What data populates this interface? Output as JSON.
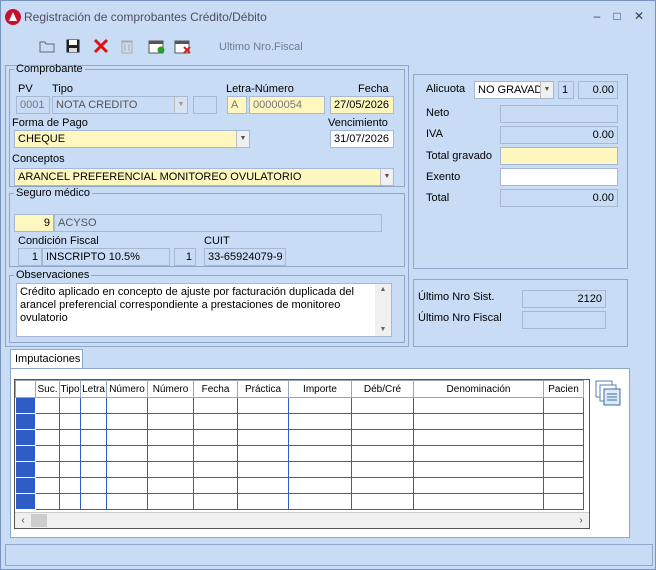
{
  "window": {
    "title": "Registración de comprobantes Crédito/Débito",
    "minimize": "–",
    "restore": "□",
    "close": "✕"
  },
  "toolbar": {
    "ultimo_nro_fiscal": "Ultimo Nro.Fiscal"
  },
  "comprobante": {
    "legend": "Comprobante",
    "pv_label": "PV",
    "pv": "0001",
    "tipo_label": "Tipo",
    "tipo": "NOTA CREDITO",
    "letra_numero_label": "Letra-Número",
    "letra": "A",
    "numero": "00000054",
    "fecha_label": "Fecha",
    "fecha": "27/05/2026",
    "forma_pago_label": "Forma de Pago",
    "forma_pago": "CHEQUE",
    "vencimiento_label": "Vencimiento",
    "vencimiento": "31/07/2026",
    "conceptos_label": "Conceptos",
    "concepto": "ARANCEL PREFERENCIAL  MONITOREO OVULATORIO"
  },
  "seguro": {
    "legend": "Seguro médico",
    "codigo": "9",
    "nombre": "ACYSO",
    "condicion_label": "Condición Fiscal",
    "condicion_codigo": "1",
    "condicion": "INSCRIPTO  10.5%",
    "condicion_num": "1",
    "cuit_label": "CUIT",
    "cuit": "33-65924079-9"
  },
  "observaciones": {
    "legend": "Observaciones",
    "text": "Crédito aplicado en concepto de ajuste por facturación duplicada del arancel preferencial correspondiente a prestaciones de monitoreo ovulatorio"
  },
  "totales": {
    "alicuota_label": "Alicuota",
    "alicuota": "NO GRAVAD",
    "alicuota_num": "1",
    "alicuota_valor": "0.00",
    "neto_label": "Neto",
    "neto": "",
    "iva_label": "IVA",
    "iva": "0.00",
    "total_gravado_label": "Total gravado",
    "total_gravado": "",
    "exento_label": "Exento",
    "exento": "",
    "total_label": "Total",
    "total": "0.00"
  },
  "sistema": {
    "ultimo_nro_sist_label": "Último Nro Sist.",
    "ultimo_nro_sist": "2120",
    "ultimo_nro_fiscal_label": "Último Nro Fiscal",
    "ultimo_nro_fiscal": ""
  },
  "imputaciones": {
    "tab": "Imputaciones",
    "columns": [
      "Suc.",
      "Tipo",
      "Letra",
      "Número",
      "Número",
      "Fecha",
      "Práctica",
      "Importe",
      "Déb/Cré",
      "Denominación",
      "Pacien"
    ]
  }
}
